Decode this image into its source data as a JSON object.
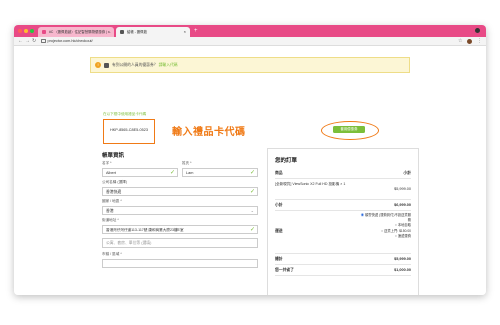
{
  "browser": {
    "tabs": [
      {
        "label": "#C 〈蕭佩茹創〉住記智慧購物優惠券 | ...",
        "active": false
      },
      {
        "label": "結帳 - 蕭佩茹",
        "active": true
      }
    ],
    "new_tab": "+",
    "url": "projector.com.hk/checkout/",
    "colors": {
      "tabbar": "#e84a86",
      "active_tab": "#f4f4f4"
    }
  },
  "notice": {
    "text": "有到公開的人員的優惠券？",
    "link": "請輸入代碼"
  },
  "coupon": {
    "prompt": "在以下框中使用禮品卡代碼",
    "value": "HKP-8565-C8E5-0523",
    "callout": "輸入禮品卡代碼",
    "apply_label": "套用優惠券"
  },
  "billing": {
    "title": "帳單資訊",
    "first_name_label": "名字 *",
    "first_name_value": "Albert",
    "last_name_label": "姓氏 *",
    "last_name_value": "Lam",
    "company_label": "公司名稱 (選擇)",
    "company_value": "香港快遞",
    "country_label": "國家 / 地區 *",
    "country_value": "香港",
    "address_label": "街道地址 *",
    "address_value": "香港灣仔灣仔道113-117號 康和商業大廈23樓E室",
    "address2_placeholder": "公寓、套房、單位等 (選填)",
    "city_label": "市鎮 / 區域 *"
  },
  "order": {
    "title": "您的訂單",
    "col_product": "商品",
    "col_subtotal": "小計",
    "item_name": "[全新現貨] ViewSonic X2 Full HD 投影機 × 1",
    "item_price": "$5,999.00",
    "subtotal_label": "小計",
    "subtotal_value": "$6,999.00",
    "shipping_label": "運送",
    "shipping_options": [
      {
        "label": "順豐快遞 (運費到付)不設送貨服務",
        "selected": true
      },
      {
        "label": "本地自取",
        "selected": false
      },
      {
        "label": "送貨上門: $150.00",
        "selected": false
      },
      {
        "label": "速遞運費",
        "selected": false
      }
    ],
    "total_label": "總計",
    "total_value": "$5,999.00",
    "savings_label": "您一共省了",
    "savings_value": "$1,000.00"
  },
  "accent": "#7cbf3a",
  "highlight": "#f07a16"
}
